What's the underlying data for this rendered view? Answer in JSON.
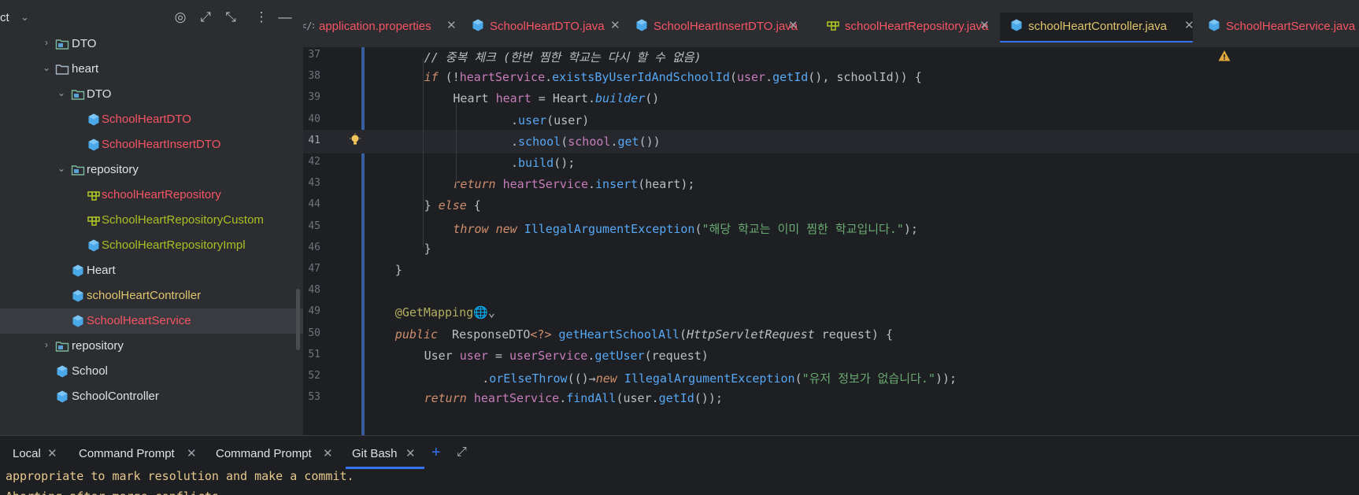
{
  "project_panel": {
    "title": "ct",
    "tree": [
      {
        "label": "DTO",
        "icon": "package-folder-icon",
        "arrow": "›",
        "color": "#dfe1e5"
      },
      {
        "label": "heart",
        "icon": "folder-icon",
        "arrow": "⌄",
        "color": "#dfe1e5"
      },
      {
        "label": "DTO",
        "icon": "package-folder-icon",
        "arrow": "⌄",
        "color": "#dfe1e5"
      },
      {
        "label": "SchoolHeartDTO",
        "icon": "class-icon",
        "arrow": "",
        "color": "#f75464"
      },
      {
        "label": "SchoolHeartInsertDTO",
        "icon": "class-icon",
        "arrow": "",
        "color": "#f75464"
      },
      {
        "label": "repository",
        "icon": "package-folder-icon",
        "arrow": "⌄",
        "color": "#dfe1e5"
      },
      {
        "label": "schoolHeartRepository",
        "icon": "interface-icon",
        "arrow": "",
        "color": "#f75464"
      },
      {
        "label": "SchoolHeartRepositoryCustom",
        "icon": "interface-icon",
        "arrow": "",
        "color": "#a8c023"
      },
      {
        "label": "SchoolHeartRepositoryImpl",
        "icon": "class-icon",
        "arrow": "",
        "color": "#a8c023"
      },
      {
        "label": "Heart",
        "icon": "class-icon",
        "arrow": "",
        "color": "#dfe1e5"
      },
      {
        "label": "schoolHeartController",
        "icon": "class-icon",
        "arrow": "",
        "color": "#e0c46c"
      },
      {
        "label": "SchoolHeartService",
        "icon": "class-icon",
        "arrow": "",
        "color": "#f75464"
      },
      {
        "label": "repository",
        "icon": "package-folder-icon",
        "arrow": "›",
        "color": "#dfe1e5"
      },
      {
        "label": "School",
        "icon": "class-icon",
        "arrow": "",
        "color": "#dfe1e5"
      },
      {
        "label": "SchoolController",
        "icon": "class-icon",
        "arrow": "",
        "color": "#dfe1e5"
      }
    ],
    "header_buttons": [
      "target-icon",
      "expand-icon",
      "collapse-icon",
      "more-options-icon",
      "minimize-icon"
    ]
  },
  "tabs": [
    {
      "label": "application.properties",
      "icon": "properties-icon",
      "color": "#f75464",
      "active": false
    },
    {
      "label": "SchoolHeartDTO.java",
      "icon": "class-icon",
      "color": "#f75464",
      "active": false
    },
    {
      "label": "SchoolHeartInsertDTO.java",
      "icon": "class-icon",
      "color": "#f75464",
      "active": false
    },
    {
      "label": "schoolHeartRepository.java",
      "icon": "interface-icon",
      "color": "#f75464",
      "active": false
    },
    {
      "label": "schoolHeartController.java",
      "icon": "class-icon",
      "color": "#e0c46c",
      "active": true
    },
    {
      "label": "SchoolHeartService.java",
      "icon": "class-icon",
      "color": "#f75464",
      "active": false
    }
  ],
  "editor": {
    "current_line": 41,
    "lines": [
      {
        "num": "37",
        "tokens": [
          [
            "cmt",
            "// 중복 체크 (한번 찜한 학교는 다시 할 수 없음)"
          ]
        ],
        "indent": 2
      },
      {
        "num": "38",
        "tokens": [
          [
            "kwi",
            "if"
          ],
          [
            "type",
            " (!"
          ],
          [
            "var",
            "heartService"
          ],
          [
            "type",
            "."
          ],
          [
            "fn",
            "existsByUserIdAndSchoolId"
          ],
          [
            "type",
            "("
          ],
          [
            "var",
            "user"
          ],
          [
            "type",
            "."
          ],
          [
            "fn",
            "getId"
          ],
          [
            "type",
            "(), schoolId)) {"
          ]
        ],
        "indent": 2
      },
      {
        "num": "39",
        "tokens": [
          [
            "type",
            "Heart "
          ],
          [
            "var",
            "heart"
          ],
          [
            "type",
            " = Heart."
          ],
          [
            "fni",
            "builder"
          ],
          [
            "type",
            "()"
          ]
        ],
        "indent": 3
      },
      {
        "num": "40",
        "tokens": [
          [
            "type",
            "."
          ],
          [
            "fn",
            "user"
          ],
          [
            "type",
            "(user)"
          ]
        ],
        "indent": 5
      },
      {
        "num": "41",
        "tokens": [
          [
            "type",
            "."
          ],
          [
            "fn",
            "school"
          ],
          [
            "type",
            "("
          ],
          [
            "var",
            "school"
          ],
          [
            "type",
            "."
          ],
          [
            "fn",
            "get"
          ],
          [
            "type",
            "())"
          ]
        ],
        "indent": 5
      },
      {
        "num": "42",
        "tokens": [
          [
            "type",
            "."
          ],
          [
            "fn",
            "build"
          ],
          [
            "type",
            "();"
          ]
        ],
        "indent": 5
      },
      {
        "num": "43",
        "tokens": [
          [
            "kwi",
            "return"
          ],
          [
            "type",
            " "
          ],
          [
            "var",
            "heartService"
          ],
          [
            "type",
            "."
          ],
          [
            "fn",
            "insert"
          ],
          [
            "type",
            "(heart);"
          ]
        ],
        "indent": 3
      },
      {
        "num": "44",
        "tokens": [
          [
            "type",
            "} "
          ],
          [
            "kwi",
            "else"
          ],
          [
            "type",
            " {"
          ]
        ],
        "indent": 2
      },
      {
        "num": "45",
        "tokens": [
          [
            "kwi",
            "throw"
          ],
          [
            "type",
            " "
          ],
          [
            "kwi",
            "new"
          ],
          [
            "type",
            " "
          ],
          [
            "fn",
            "IllegalArgumentException"
          ],
          [
            "type",
            "("
          ],
          [
            "str",
            "\"해당 학교는 이미 찜한 학교입니다.\""
          ],
          [
            "type",
            ");"
          ]
        ],
        "indent": 3
      },
      {
        "num": "46",
        "tokens": [
          [
            "type",
            "}"
          ]
        ],
        "indent": 2
      },
      {
        "num": "47",
        "tokens": [
          [
            "type",
            "}"
          ]
        ],
        "indent": 1
      },
      {
        "num": "48",
        "tokens": [],
        "indent": 1
      },
      {
        "num": "49",
        "tokens": [
          [
            "anno",
            "@GetMapping"
          ],
          [
            "type",
            "🌐⌄"
          ]
        ],
        "indent": 1
      },
      {
        "num": "50",
        "tokens": [
          [
            "kwi",
            "public"
          ],
          [
            "type",
            "  "
          ],
          [
            "type",
            "ResponseDTO"
          ],
          [
            "kw",
            "<?>"
          ],
          [
            "type",
            " "
          ],
          [
            "fn",
            "getHeartSchoolAll"
          ],
          [
            "type",
            "("
          ],
          [
            "clsi",
            "HttpServletRequest"
          ],
          [
            "type",
            " request) {"
          ]
        ],
        "indent": 1
      },
      {
        "num": "51",
        "tokens": [
          [
            "type",
            "User "
          ],
          [
            "var",
            "user"
          ],
          [
            "type",
            " = "
          ],
          [
            "var",
            "userService"
          ],
          [
            "type",
            "."
          ],
          [
            "fn",
            "getUser"
          ],
          [
            "type",
            "(request)"
          ]
        ],
        "indent": 2
      },
      {
        "num": "52",
        "tokens": [
          [
            "type",
            "."
          ],
          [
            "fn",
            "orElseThrow"
          ],
          [
            "type",
            "(()→"
          ],
          [
            "kwi",
            "new"
          ],
          [
            "type",
            " "
          ],
          [
            "fn",
            "IllegalArgumentException"
          ],
          [
            "type",
            "("
          ],
          [
            "str",
            "\"유저 정보가 없습니다.\""
          ],
          [
            "type",
            "));"
          ]
        ],
        "indent": 4
      },
      {
        "num": "53",
        "tokens": [
          [
            "kwi",
            "return"
          ],
          [
            "type",
            " "
          ],
          [
            "var",
            "heartService"
          ],
          [
            "type",
            "."
          ],
          [
            "fn",
            "findAll"
          ],
          [
            "type",
            "(user."
          ],
          [
            "fn",
            "getId"
          ],
          [
            "type",
            "());"
          ]
        ],
        "indent": 2
      }
    ]
  },
  "terminal": {
    "tabs": [
      {
        "label": "Local",
        "active": false
      },
      {
        "label": "Command Prompt",
        "active": false
      },
      {
        "label": "Command Prompt",
        "active": false
      },
      {
        "label": "Git Bash",
        "active": true
      }
    ],
    "add_icon": "plus-icon",
    "expand_icon": "expand-icon",
    "lines": [
      "appropriate to mark resolution and make a commit.",
      "Aborting after merge conflicts..."
    ]
  },
  "colors": {
    "accent": "#3574f0",
    "modified_red": "#f75464",
    "class_blue": "#4aa8e8"
  }
}
